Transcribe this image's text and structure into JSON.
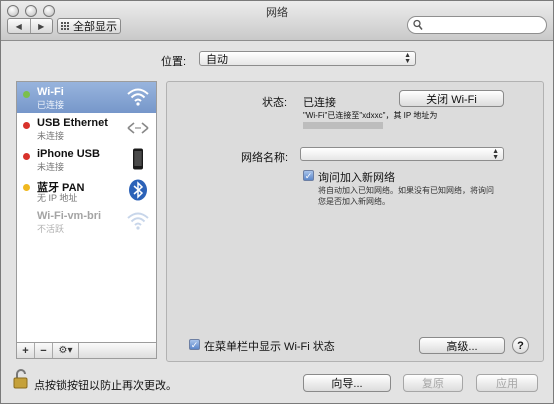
{
  "window": {
    "title": "网络"
  },
  "toolbar": {
    "show_all_label": "全部显示",
    "back_icon": "back-arrow-icon",
    "forward_icon": "forward-arrow-icon"
  },
  "location": {
    "label": "位置:",
    "value": "自动"
  },
  "services": [
    {
      "name": "Wi-Fi",
      "status": "已连接",
      "dot_color": "#7bbf4b",
      "icon": "wifi-icon"
    },
    {
      "name": "USB Ethernet",
      "status": "未连接",
      "dot_color": "#d8322b",
      "icon": "ethernet-arrows-icon"
    },
    {
      "name": "iPhone USB",
      "status": "未连接",
      "dot_color": "#d8322b",
      "icon": "iphone-icon"
    },
    {
      "name": "蓝牙 PAN",
      "status": "无 IP 地址",
      "dot_color": "#f0b81f",
      "icon": "bluetooth-icon"
    },
    {
      "name": "Wi-Fi-vm-bri",
      "status": "不活跃",
      "dot_color": "",
      "icon": "wifi-icon"
    }
  ],
  "sidebar_tools": {
    "add": "+",
    "remove": "−",
    "gear": "⚙▾"
  },
  "detail": {
    "status_label": "状态:",
    "status_value": "已连接",
    "turn_off_button": "关闭 Wi-Fi",
    "status_desc": "\"Wi-Fi\"已连接至\"xdxxc\"，其 IP 地址为",
    "network_name_label": "网络名称:",
    "network_name_value": "",
    "ask_join_label": "询问加入新网络",
    "ask_join_checked": true,
    "ask_join_desc_line1": "将自动加入已知网络。如果没有已知网络，将询问",
    "ask_join_desc_line2": "您是否加入新网络。",
    "menu_bar_label": "在菜单栏中显示 Wi-Fi 状态",
    "menu_bar_checked": true,
    "advanced_button": "高级...",
    "help_button": "?"
  },
  "footer": {
    "lock_text": "点按锁按钮以防止再次更改。",
    "assist_button": "向导...",
    "revert_button": "复原",
    "apply_button": "应用"
  }
}
